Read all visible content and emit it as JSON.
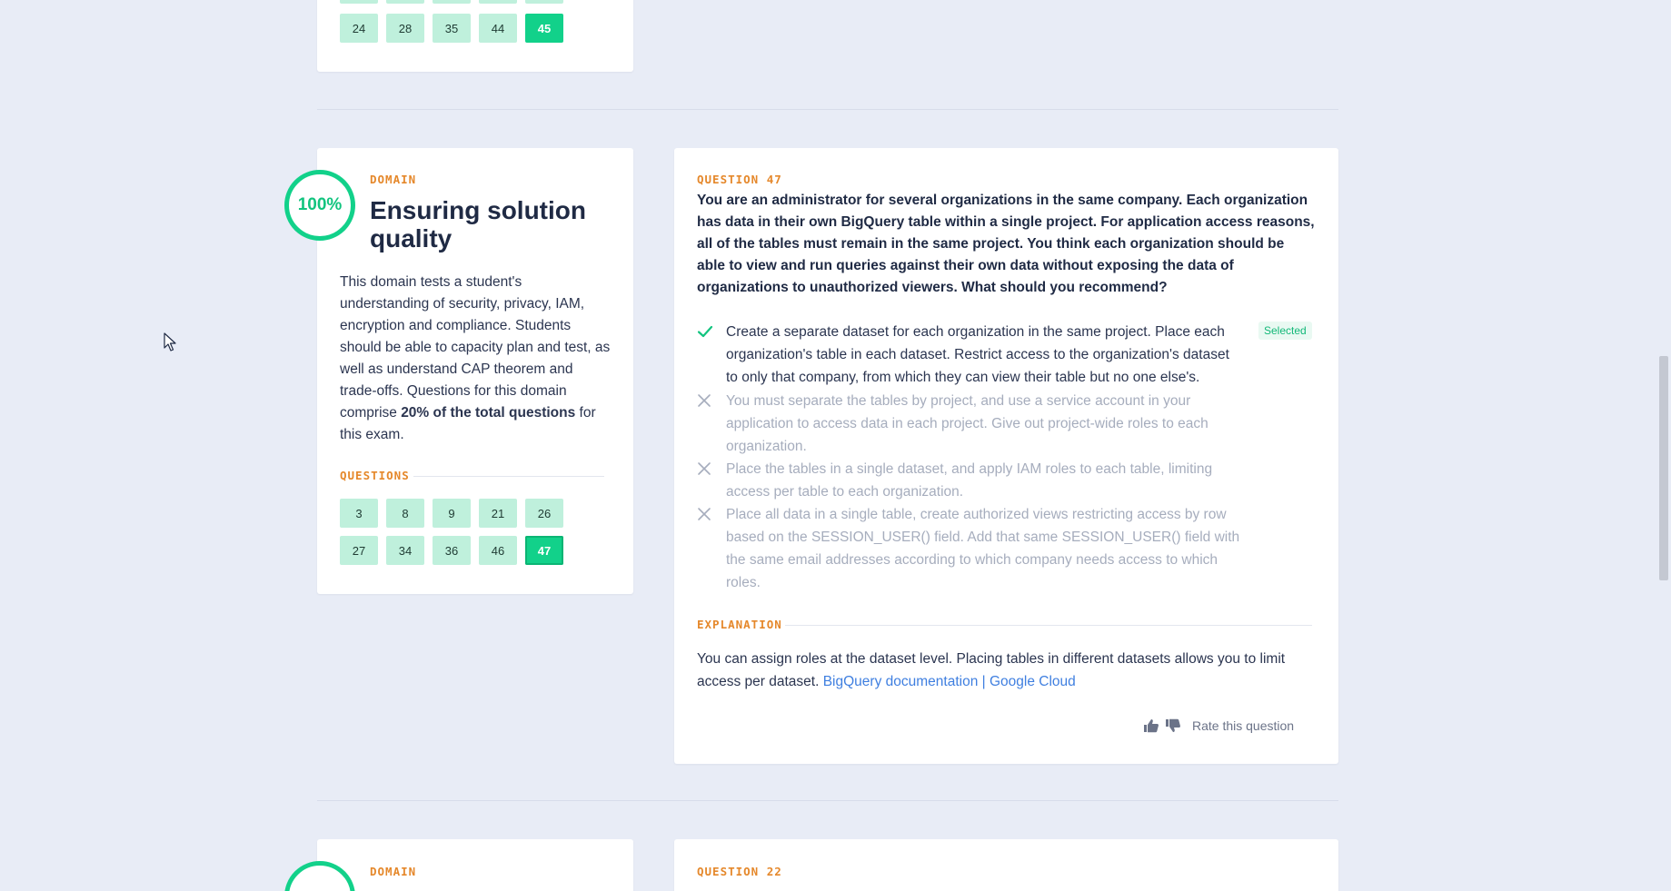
{
  "top_section": {
    "question_numbers": [
      "24",
      "28",
      "35",
      "44",
      "45"
    ],
    "active": "45"
  },
  "domain": {
    "label": "DOMAIN",
    "score": "100%",
    "title": "Ensuring solution quality",
    "description_before": "This domain tests a student's understanding of security, privacy, IAM, encryption and compliance. Students should be able to capacity plan and test, as well as understand CAP theorem and trade-offs. Questions for this domain comprise ",
    "description_bold": "20% of the total questions",
    "description_after": " for this exam.",
    "questions_label": "QUESTIONS",
    "question_numbers": [
      "3",
      "8",
      "9",
      "21",
      "26",
      "27",
      "34",
      "36",
      "46",
      "47"
    ],
    "active": "47"
  },
  "question": {
    "label": "QUESTION 47",
    "text": "You are an administrator for several organizations in the same company. Each organization has data in their own BigQuery table within a single project. For application access reasons, all of the tables must remain in the same project. You think each organization should be able to view and run queries against their own data without exposing the data of organizations to unauthorized viewers. What should you recommend?",
    "options": [
      {
        "text": "Create a separate dataset for each organization in the same project. Place each organization's table in each dataset. Restrict access to the organization's dataset to only that company, from which they can view their table but no one else's.",
        "status": "correct",
        "icon": "checkmark-icon"
      },
      {
        "text": "You must separate the tables by project, and use a service account in your application to access data in each project. Give out project-wide roles to each organization.",
        "status": "wrong",
        "icon": "x-icon"
      },
      {
        "text": "Place the tables in a single dataset, and apply IAM roles to each table, limiting access per table to each organization.",
        "status": "wrong",
        "icon": "x-icon"
      },
      {
        "text": "Place all data in a single table, create authorized views restricting access by row based on the SESSION_USER() field. Add that same SESSION_USER() field with the same email addresses according to which company needs access to which roles.",
        "status": "wrong",
        "icon": "x-icon"
      }
    ],
    "selected_label": "Selected",
    "explanation_label": "EXPLANATION",
    "explanation_text": "You can assign roles at the dataset level. Placing tables in different datasets allows you to limit access per dataset. ",
    "explanation_link": "BigQuery documentation | Google Cloud",
    "rate_label": "Rate this question"
  },
  "next_section": {
    "domain_label": "DOMAIN",
    "question_label": "QUESTION 22"
  },
  "colors": {
    "accent_green": "#12d18a",
    "label_orange": "#e5882b",
    "link_blue": "#3f7fe0",
    "background": "#e8ecf6"
  }
}
